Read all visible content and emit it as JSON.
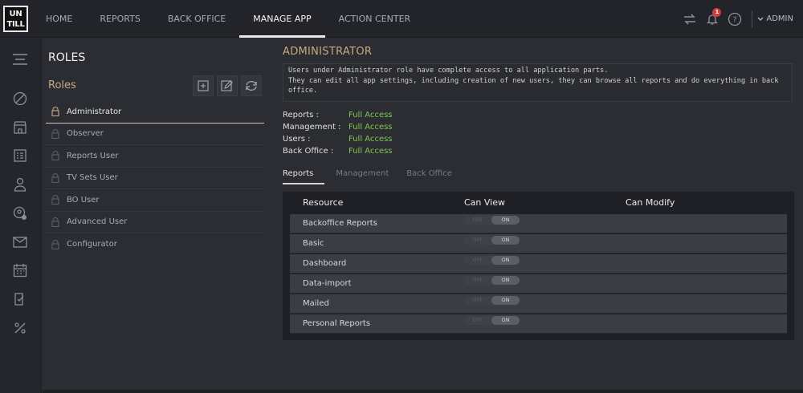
{
  "logo": {
    "line1": "UN",
    "line2": "TILL"
  },
  "nav": [
    {
      "label": "HOME",
      "active": false
    },
    {
      "label": "REPORTS",
      "active": false
    },
    {
      "label": "BACK OFFICE",
      "active": false
    },
    {
      "label": "MANAGE APP",
      "active": true
    },
    {
      "label": "ACTION CENTER",
      "active": false
    }
  ],
  "topbar": {
    "notification_count": "1",
    "user_label": "ADMIN"
  },
  "roles": {
    "heading": "ROLES",
    "subheading": "Roles",
    "items": [
      {
        "label": "Administrator",
        "active": true
      },
      {
        "label": "Observer",
        "active": false
      },
      {
        "label": "Reports User",
        "active": false
      },
      {
        "label": "TV Sets User",
        "active": false
      },
      {
        "label": "BO User",
        "active": false
      },
      {
        "label": "Advanced User",
        "active": false
      },
      {
        "label": "Configurator",
        "active": false
      }
    ]
  },
  "detail": {
    "title": "ADMINISTRATOR",
    "description_line1": "Users under Administrator role have complete access to all application parts.",
    "description_line2": "They can edit all app settings, including creation of new users, they can browse all reports and do everything in back",
    "description_line3": "office.",
    "access": [
      {
        "key": "Reports :",
        "value": "Full Access"
      },
      {
        "key": "Management :",
        "value": "Full Access"
      },
      {
        "key": "Users :",
        "value": "Full Access"
      },
      {
        "key": "Back Office :",
        "value": "Full Access"
      }
    ],
    "tabs": [
      {
        "label": "Reports",
        "active": true
      },
      {
        "label": "Management",
        "active": false
      },
      {
        "label": "Back Office",
        "active": false
      }
    ]
  },
  "table": {
    "headers": {
      "resource": "Resource",
      "can_view": "Can View",
      "can_modify": "Can Modify"
    },
    "toggle_off": "OFF",
    "toggle_on": "ON",
    "rows": [
      {
        "resource": "Backoffice Reports",
        "can_view": "ON"
      },
      {
        "resource": "Basic",
        "can_view": "ON"
      },
      {
        "resource": "Dashboard",
        "can_view": "ON"
      },
      {
        "resource": "Data-import",
        "can_view": "ON"
      },
      {
        "resource": "Mailed",
        "can_view": "ON"
      },
      {
        "resource": "Personal Reports",
        "can_view": "ON"
      }
    ]
  },
  "icons": {
    "rail": [
      "menu-icon",
      "compass-icon",
      "store-icon",
      "cash-register-icon",
      "user-icon",
      "user-settings-icon",
      "mail-icon",
      "calendar-icon",
      "checklist-icon",
      "discount-icon"
    ],
    "top": [
      "transfer-icon",
      "bell-icon",
      "help-icon",
      "chevron-down-icon"
    ],
    "tools": [
      "add-icon",
      "edit-icon",
      "refresh-icon"
    ],
    "role": "lock-icon"
  },
  "colors": {
    "accent": "#c7aa7e",
    "full_access": "#7ec84d",
    "badge": "#d33a3a"
  }
}
